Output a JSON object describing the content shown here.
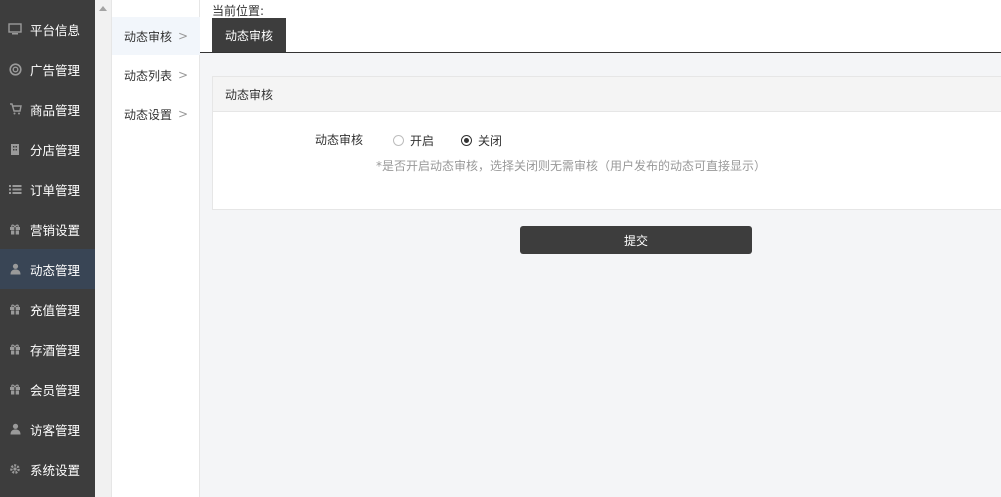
{
  "sidebar": {
    "items": [
      {
        "label": "平台信息",
        "icon": "monitor-icon"
      },
      {
        "label": "广告管理",
        "icon": "lifebuoy-icon"
      },
      {
        "label": "商品管理",
        "icon": "cart-icon"
      },
      {
        "label": "分店管理",
        "icon": "building-icon"
      },
      {
        "label": "订单管理",
        "icon": "list-icon"
      },
      {
        "label": "营销设置",
        "icon": "gift-icon"
      },
      {
        "label": "动态管理",
        "icon": "user-icon",
        "active": true
      },
      {
        "label": "充值管理",
        "icon": "gift-icon"
      },
      {
        "label": "存酒管理",
        "icon": "gift-icon"
      },
      {
        "label": "会员管理",
        "icon": "gift-icon"
      },
      {
        "label": "访客管理",
        "icon": "user-icon"
      },
      {
        "label": "系统设置",
        "icon": "gear-icon"
      }
    ]
  },
  "submenu": {
    "items": [
      {
        "label": "动态审核",
        "active": true
      },
      {
        "label": "动态列表"
      },
      {
        "label": "动态设置"
      }
    ],
    "arrow": ">"
  },
  "breadcrumb": {
    "label": "当前位置:"
  },
  "tab": {
    "label": "动态审核"
  },
  "panel": {
    "title": "动态审核",
    "field_label": "动态审核",
    "options": [
      {
        "label": "开启",
        "checked": false
      },
      {
        "label": "关闭",
        "checked": true
      }
    ],
    "hint": "*是否开启动态审核，选择关闭则无需审核（用户发布的动态可直接显示）"
  },
  "submit": {
    "label": "提交"
  },
  "colors": {
    "sidebar_bg": "#3d3d3d",
    "sidebar_active": "#394555",
    "button_bg": "#3d3d3d",
    "main_bg": "#f4f5f7"
  }
}
